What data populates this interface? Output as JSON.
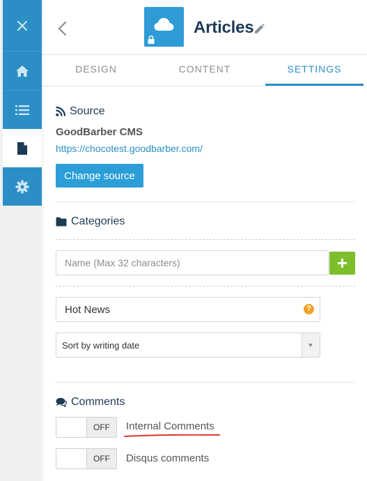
{
  "rail": {
    "items": [
      {
        "name": "close-icon"
      },
      {
        "name": "home-icon"
      },
      {
        "name": "list-icon"
      },
      {
        "name": "document-icon",
        "active": true
      },
      {
        "name": "gear-icon"
      }
    ]
  },
  "header": {
    "title": "Articles"
  },
  "tabs": [
    {
      "label": "DESIGN",
      "active": false
    },
    {
      "label": "CONTENT",
      "active": false
    },
    {
      "label": "SETTINGS",
      "active": true
    }
  ],
  "source": {
    "heading": "Source",
    "name": "GoodBarber CMS",
    "url": "https://chocotest.goodbarber.com/",
    "button": "Change source"
  },
  "categories": {
    "heading": "Categories",
    "placeholder": "Name (Max 32 characters)",
    "items": [
      "Hot News"
    ],
    "sort": "Sort by writing date"
  },
  "comments": {
    "heading": "Comments",
    "toggles": [
      {
        "label": "Internal Comments",
        "state": "OFF"
      },
      {
        "label": "Disqus comments",
        "state": "OFF"
      }
    ]
  },
  "colors": {
    "primary": "#2b8fc6",
    "add_button": "#7cbf2b",
    "help_badge": "#f0a32a",
    "annotation": "#d9342b"
  }
}
